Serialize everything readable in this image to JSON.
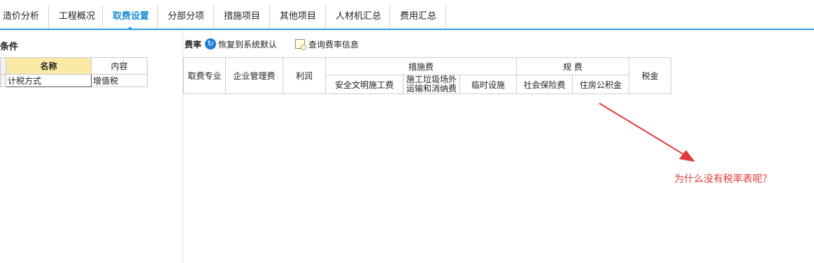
{
  "tabs": [
    {
      "label": "造价分析"
    },
    {
      "label": "工程概况"
    },
    {
      "label": "取费设置"
    },
    {
      "label": "分部分项"
    },
    {
      "label": "措施项目"
    },
    {
      "label": "其他项目"
    },
    {
      "label": "人材机汇总"
    },
    {
      "label": "费用汇总"
    }
  ],
  "left_panel": {
    "title": "用条件",
    "headers": {
      "name": "名称",
      "content": "内容"
    },
    "rows": [
      {
        "name": "计税方式",
        "content": "增值税"
      }
    ]
  },
  "toolbar": {
    "label": "费率",
    "restore_label": "恢复到系统默认",
    "query_label": "查询费率信息"
  },
  "rate_table": {
    "col_category": "取费专业",
    "col_management": "企业管理费",
    "col_profit": "利润",
    "group_measures": "措施费",
    "col_safety": "安全文明施工费",
    "col_garbage_1": "施工垃圾场外",
    "col_garbage_2": "运输和消纳费",
    "col_temporary": "临时设施",
    "group_fees": "规 费",
    "col_social": "社会保险费",
    "col_housing": "住房公积金",
    "col_tax": "税金"
  },
  "annotation": {
    "text": "为什么没有税率表呢？",
    "color": "#e5383b"
  },
  "accent": "#2b9be0"
}
